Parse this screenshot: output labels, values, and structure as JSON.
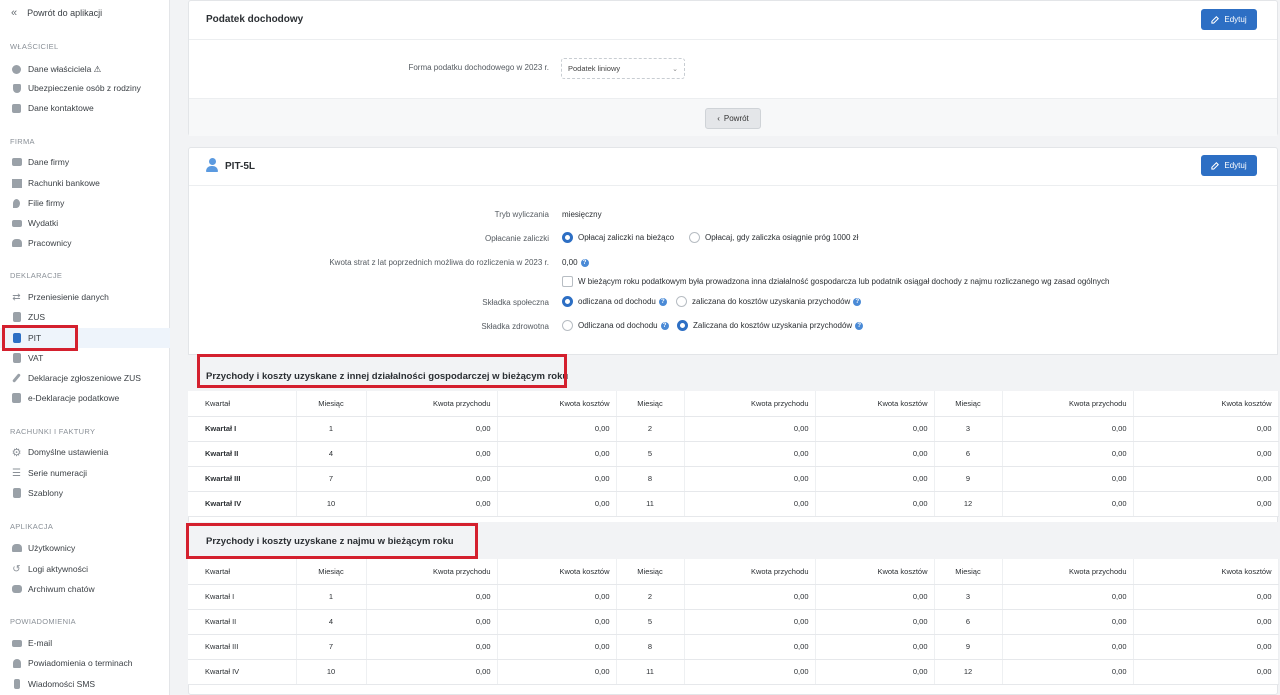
{
  "sidebar": {
    "back_label": "Powrót do aplikacji",
    "sections": [
      {
        "title": "WŁAŚCICIEL",
        "items": [
          "Dane właściciela ⚠",
          "Ubezpieczenie osób z rodziny",
          "Dane kontaktowe"
        ]
      },
      {
        "title": "FIRMA",
        "items": [
          "Dane firmy",
          "Rachunki bankowe",
          "Filie firmy",
          "Wydatki",
          "Pracownicy"
        ]
      },
      {
        "title": "DEKLARACJE",
        "items": [
          "Przeniesienie danych",
          "ZUS",
          "PIT",
          "VAT",
          "Deklaracje zgłoszeniowe ZUS",
          "e-Deklaracje podatkowe"
        ]
      },
      {
        "title": "RACHUNKI I FAKTURY",
        "items": [
          "Domyślne ustawienia",
          "Serie numeracji",
          "Szablony"
        ]
      },
      {
        "title": "APLIKACJA",
        "items": [
          "Użytkownicy",
          "Logi aktywności",
          "Archiwum chatów"
        ]
      },
      {
        "title": "POWIADOMIENIA",
        "items": [
          "E-mail",
          "Powiadomienia o terminach",
          "Wiadomości SMS"
        ]
      }
    ]
  },
  "income_tax": {
    "title": "Podatek dochodowy",
    "edit_label": "Edytuj",
    "form_label": "Forma podatku dochodowego w 2023 r.",
    "form_value": "Podatek liniowy",
    "back_button": "Powrót"
  },
  "pit": {
    "title": "PIT-5L",
    "edit_label": "Edytuj",
    "mode_label": "Tryb wyliczania",
    "mode_value": "miesięczny",
    "advance_label": "Opłacanie zaliczki",
    "advance_opt1": "Opłacaj zaliczki na bieżąco",
    "advance_opt2": "Opłacaj, gdy zaliczka osiągnie próg 1000 zł",
    "loss_label": "Kwota strat z lat poprzednich możliwa do rozliczenia w 2023 r.",
    "loss_value": "0,00",
    "checkbox_text": "W bieżącym roku podatkowym była prowadzona inna działalność gospodarcza lub podatnik osiągał dochody z najmu rozliczanego wg zasad ogólnych",
    "social_label": "Składka społeczna",
    "social_opt1": "odliczana od dochodu",
    "social_opt2": "zaliczana do kosztów uzyskania przychodów",
    "health_label": "Składka zdrowotna",
    "health_opt1": "Odliczana od dochodu",
    "health_opt2": "Zaliczana do kosztów uzyskania przychodów"
  },
  "table_headers": [
    "Kwartał",
    "Miesiąc",
    "Kwota przychodu",
    "Kwota kosztów",
    "Miesiąc",
    "Kwota przychodu",
    "Kwota kosztów",
    "Miesiąc",
    "Kwota przychodu",
    "Kwota kosztów"
  ],
  "business": {
    "title": "Przychody i koszty uzyskane z innej działalności gospodarczej w bieżącym roku",
    "rows": [
      [
        "Kwartał I",
        "1",
        "0,00",
        "0,00",
        "2",
        "0,00",
        "0,00",
        "3",
        "0,00",
        "0,00"
      ],
      [
        "Kwartał II",
        "4",
        "0,00",
        "0,00",
        "5",
        "0,00",
        "0,00",
        "6",
        "0,00",
        "0,00"
      ],
      [
        "Kwartał III",
        "7",
        "0,00",
        "0,00",
        "8",
        "0,00",
        "0,00",
        "9",
        "0,00",
        "0,00"
      ],
      [
        "Kwartał IV",
        "10",
        "0,00",
        "0,00",
        "11",
        "0,00",
        "0,00",
        "12",
        "0,00",
        "0,00"
      ]
    ]
  },
  "rental": {
    "title": "Przychody i koszty uzyskane z najmu w bieżącym roku",
    "rows": [
      [
        "Kwartał I",
        "1",
        "0,00",
        "0,00",
        "2",
        "0,00",
        "0,00",
        "3",
        "0,00",
        "0,00"
      ],
      [
        "Kwartał II",
        "4",
        "0,00",
        "0,00",
        "5",
        "0,00",
        "0,00",
        "6",
        "0,00",
        "0,00"
      ],
      [
        "Kwartał III",
        "7",
        "0,00",
        "0,00",
        "8",
        "0,00",
        "0,00",
        "9",
        "0,00",
        "0,00"
      ],
      [
        "Kwartał IV",
        "10",
        "0,00",
        "0,00",
        "11",
        "0,00",
        "0,00",
        "12",
        "0,00",
        "0,00"
      ]
    ]
  },
  "colors": {
    "accent": "#2d6fc4",
    "highlight": "#d4202e"
  }
}
